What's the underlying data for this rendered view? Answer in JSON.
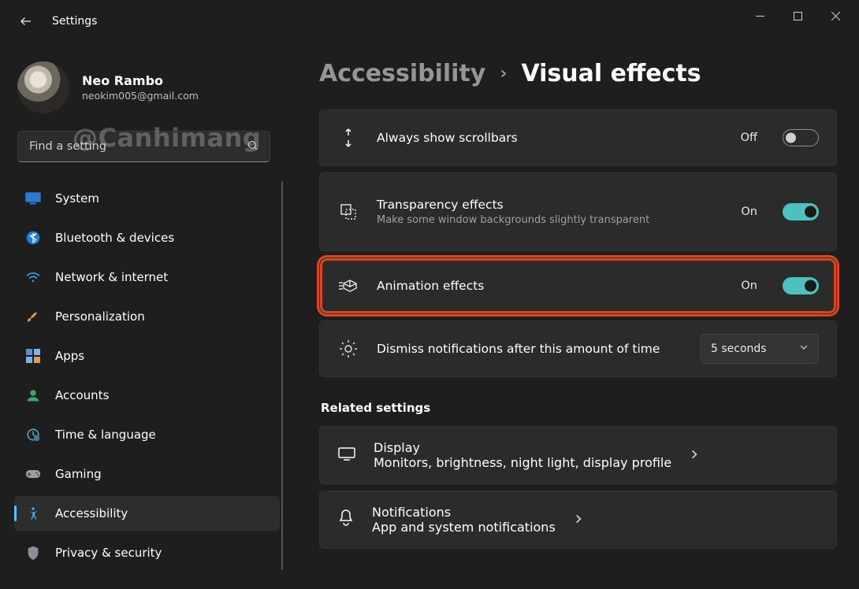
{
  "app_title": "Settings",
  "watermark": "@Canhimang",
  "window_controls": {
    "minimize": "minimize",
    "maximize": "maximize",
    "close": "close"
  },
  "user": {
    "name": "Neo Rambo",
    "email": "neokim005@gmail.com"
  },
  "search": {
    "placeholder": "Find a setting"
  },
  "sidebar": {
    "items": [
      {
        "label": "System",
        "icon": "monitor"
      },
      {
        "label": "Bluetooth & devices",
        "icon": "bluetooth"
      },
      {
        "label": "Network & internet",
        "icon": "wifi"
      },
      {
        "label": "Personalization",
        "icon": "brush"
      },
      {
        "label": "Apps",
        "icon": "apps"
      },
      {
        "label": "Accounts",
        "icon": "person"
      },
      {
        "label": "Time & language",
        "icon": "clock-globe"
      },
      {
        "label": "Gaming",
        "icon": "gamepad"
      },
      {
        "label": "Accessibility",
        "icon": "accessibility",
        "active": true
      },
      {
        "label": "Privacy & security",
        "icon": "shield"
      }
    ]
  },
  "breadcrumb": {
    "parent": "Accessibility",
    "separator": "›",
    "current": "Visual effects"
  },
  "settings": {
    "scrollbars": {
      "title": "Always show scrollbars",
      "state_label": "Off",
      "on": false
    },
    "transparency": {
      "title": "Transparency effects",
      "desc": "Make some window backgrounds slightly transparent",
      "state_label": "On",
      "on": true
    },
    "animation": {
      "title": "Animation effects",
      "state_label": "On",
      "on": true,
      "highlighted": true
    },
    "dismiss": {
      "title": "Dismiss notifications after this amount of time",
      "value": "5 seconds"
    }
  },
  "related": {
    "heading": "Related settings",
    "items": [
      {
        "title": "Display",
        "desc": "Monitors, brightness, night light, display profile"
      },
      {
        "title": "Notifications",
        "desc": "App and system notifications"
      }
    ]
  }
}
